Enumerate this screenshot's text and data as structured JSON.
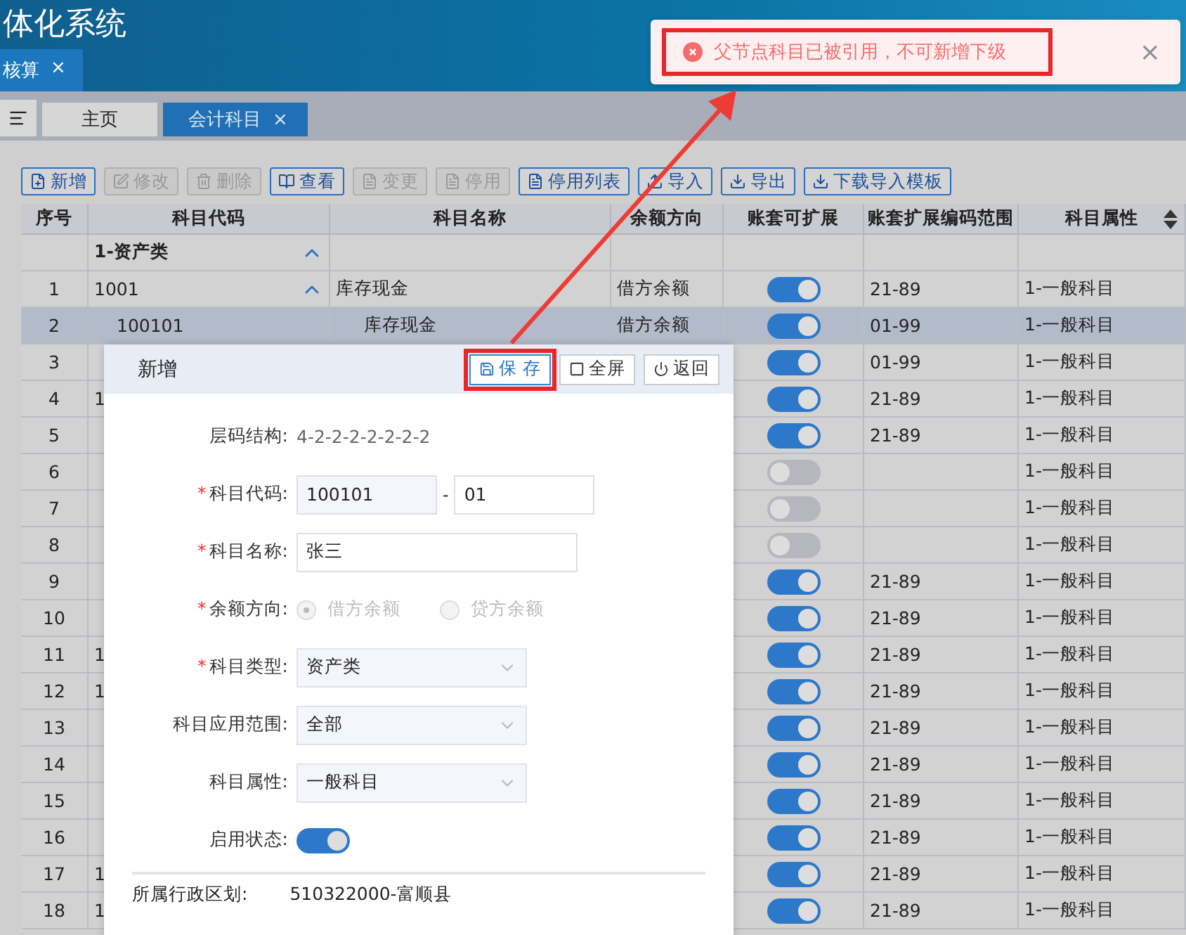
{
  "app": {
    "title": "体化系统",
    "top_tab": {
      "label": "核算",
      "close": "×"
    }
  },
  "tabs": [
    {
      "label": "主页",
      "selected": false
    },
    {
      "label": "会计科目",
      "selected": true,
      "close": "×"
    }
  ],
  "toolbar": [
    {
      "label": "新增",
      "disabled": false
    },
    {
      "label": "修改",
      "disabled": true
    },
    {
      "label": "删除",
      "disabled": true
    },
    {
      "label": "查看",
      "disabled": false
    },
    {
      "label": "变更",
      "disabled": true
    },
    {
      "label": "停用",
      "disabled": true
    },
    {
      "label": "停用列表",
      "disabled": false
    },
    {
      "label": "导入",
      "disabled": false
    },
    {
      "label": "导出",
      "disabled": false
    },
    {
      "label": "下载导入模板",
      "disabled": false
    }
  ],
  "table": {
    "columns": [
      "序号",
      "科目代码",
      "科目名称",
      "余额方向",
      "账套可扩展",
      "账套扩展编码范围",
      "科目属性"
    ],
    "group": {
      "label": "1-资产类",
      "expanded": true
    },
    "rows": [
      {
        "seq": "1",
        "code": "1001",
        "expanded": true,
        "name": "库存现金",
        "direction": "借方余额",
        "expandable": true,
        "range": "21-89",
        "attr": "1-一般科目",
        "selected": false
      },
      {
        "seq": "2",
        "code": "100101",
        "name": "库存现金",
        "direction": "借方余额",
        "expandable": true,
        "range": "01-99",
        "attr": "1-一般科目",
        "selected": true
      },
      {
        "seq": "3",
        "expandable": true,
        "range": "01-99",
        "attr": "1-一般科目",
        "selected": false
      },
      {
        "seq": "4",
        "code": "1",
        "expandable": true,
        "range": "21-89",
        "attr": "1-一般科目",
        "selected": false
      },
      {
        "seq": "5",
        "expandable": true,
        "range": "21-89",
        "attr": "1-一般科目",
        "selected": false
      },
      {
        "seq": "6",
        "expandable": false,
        "attr": "1-一般科目",
        "selected": false
      },
      {
        "seq": "7",
        "expandable": false,
        "attr": "1-一般科目",
        "selected": false
      },
      {
        "seq": "8",
        "expandable": false,
        "attr": "1-一般科目",
        "selected": false
      },
      {
        "seq": "9",
        "expandable": true,
        "range": "21-89",
        "attr": "1-一般科目",
        "selected": false
      },
      {
        "seq": "10",
        "expandable": true,
        "range": "21-89",
        "attr": "1-一般科目",
        "selected": false
      },
      {
        "seq": "11",
        "code": "1",
        "expandable": true,
        "range": "21-89",
        "attr": "1-一般科目",
        "selected": false
      },
      {
        "seq": "12",
        "code": "1",
        "expandable": true,
        "range": "21-89",
        "attr": "1-一般科目",
        "selected": false
      },
      {
        "seq": "13",
        "expandable": true,
        "range": "21-89",
        "attr": "1-一般科目",
        "selected": false
      },
      {
        "seq": "14",
        "expandable": true,
        "range": "21-89",
        "attr": "1-一般科目",
        "selected": false
      },
      {
        "seq": "15",
        "expandable": true,
        "range": "21-89",
        "attr": "1-一般科目",
        "selected": false
      },
      {
        "seq": "16",
        "expandable": true,
        "range": "21-89",
        "attr": "1-一般科目",
        "selected": false
      },
      {
        "seq": "17",
        "code": "1",
        "expandable": true,
        "range": "21-89",
        "attr": "1-一般科目",
        "selected": false
      },
      {
        "seq": "18",
        "code": "1",
        "expandable": true,
        "range": "21-89",
        "attr": "1-一般科目",
        "selected": false
      }
    ]
  },
  "dialog": {
    "title": "新增",
    "buttons": [
      {
        "label": "保 存",
        "highlighted": true
      },
      {
        "label": "全屏",
        "highlighted": false
      },
      {
        "label": "返回",
        "highlighted": false
      }
    ],
    "fields": [
      {
        "kind": "text",
        "label": "层码结构:",
        "value": "4-2-2-2-2-2-2-2"
      },
      {
        "kind": "code",
        "label": "科目代码:",
        "required_mark": "*",
        "prefix": "100101",
        "separator": "-",
        "value": "01"
      },
      {
        "kind": "input",
        "label": "科目名称:",
        "required_mark": "*",
        "value": "张三"
      },
      {
        "kind": "radio",
        "label": "余额方向:",
        "required_mark": "*",
        "disabled": true,
        "options": [
          {
            "label": "借方余额",
            "selected": true
          },
          {
            "label": "贷方余额",
            "selected": false
          }
        ]
      },
      {
        "kind": "select",
        "label": "科目类型:",
        "required_mark": "*",
        "value": "资产类"
      },
      {
        "kind": "select",
        "label": "科目应用范围:",
        "value": "全部"
      },
      {
        "kind": "select",
        "label": "科目属性:",
        "value": "一般科目"
      },
      {
        "kind": "switch",
        "label": "启用状态:",
        "on": true
      }
    ],
    "footer": {
      "label": "所属行政区划:",
      "value": "510322000-富顺县"
    }
  },
  "toast": {
    "message": "父节点科目已被引用，不可新增下级",
    "close": "×"
  }
}
